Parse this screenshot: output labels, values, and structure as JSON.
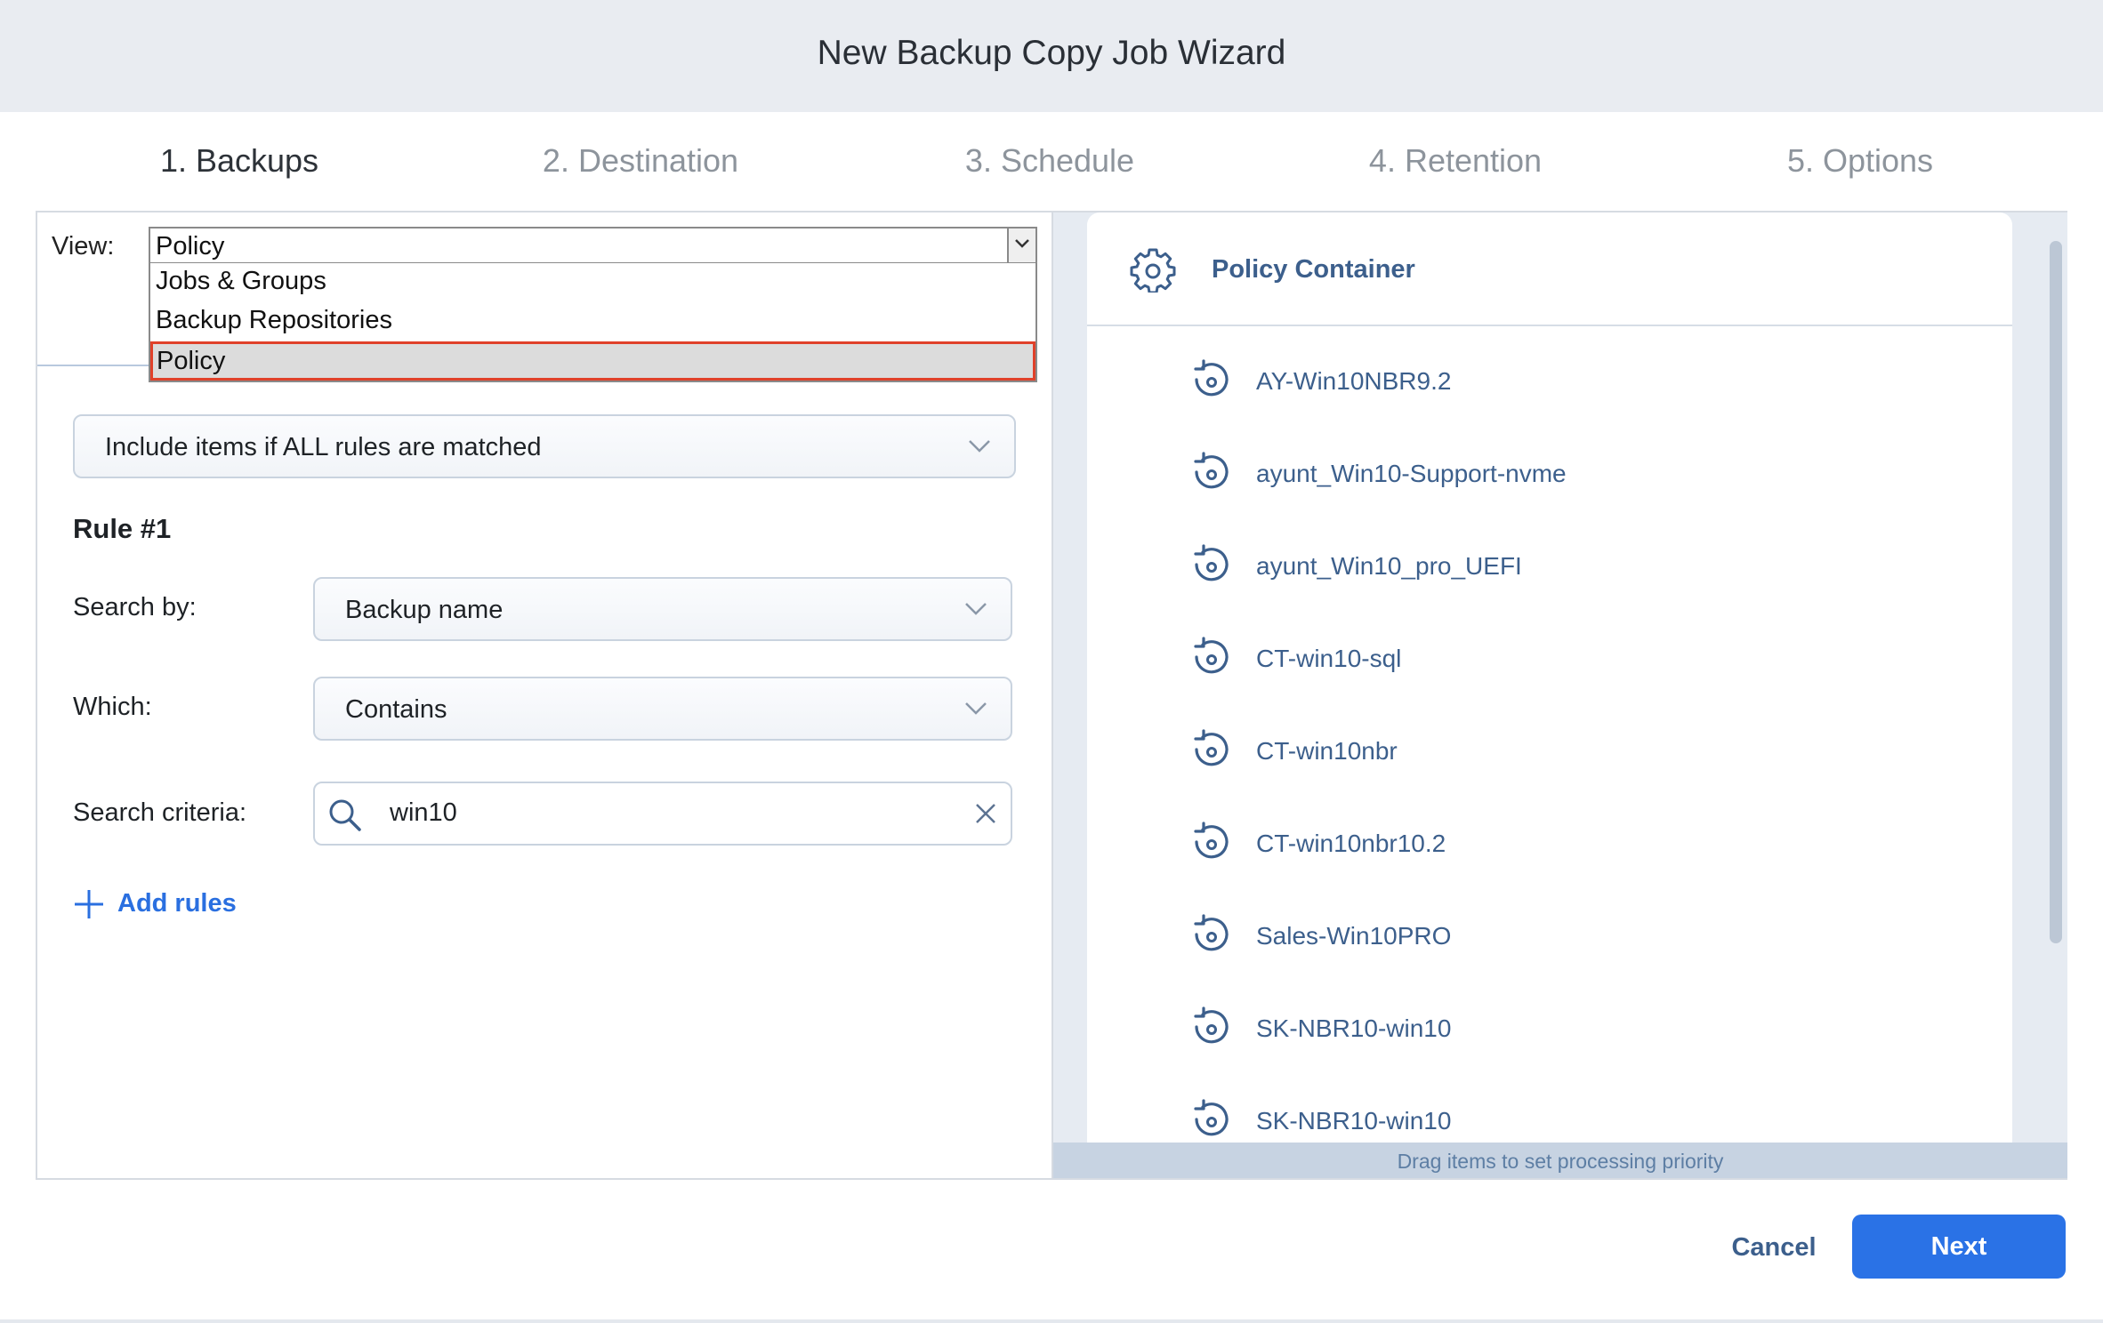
{
  "window": {
    "title": "New Backup Copy Job Wizard"
  },
  "steps": [
    {
      "label": "1. Backups",
      "active": true
    },
    {
      "label": "2. Destination",
      "active": false
    },
    {
      "label": "3. Schedule",
      "active": false
    },
    {
      "label": "4. Retention",
      "active": false
    },
    {
      "label": "5. Options",
      "active": false
    }
  ],
  "view": {
    "label": "View:",
    "selected": "Policy",
    "options": [
      "Jobs & Groups",
      "Backup Repositories",
      "Policy"
    ],
    "highlighted_option": "Policy",
    "highlight_color": "#e0412a"
  },
  "rules": {
    "match_mode": "Include items if ALL rules are matched",
    "rule_title": "Rule #1",
    "search_by_label": "Search by:",
    "search_by_value": "Backup name",
    "which_label": "Which:",
    "which_value": "Contains",
    "criteria_label": "Search criteria:",
    "criteria_value": "win10",
    "add_rules": "Add rules"
  },
  "container": {
    "title": "Policy Container",
    "icon": "gear-icon",
    "items": [
      "AY-Win10NBR9.2",
      "ayunt_Win10-Support-nvme",
      "ayunt_Win10_pro_UEFI",
      "CT-win10-sql",
      "CT-win10nbr",
      "CT-win10nbr10.2",
      "Sales-Win10PRO",
      "SK-NBR10-win10",
      "SK-NBR10-win10"
    ],
    "item_icon": "backup-restore-icon",
    "footer_hint": "Drag items to set processing priority"
  },
  "buttons": {
    "cancel": "Cancel",
    "next": "Next"
  },
  "colors": {
    "accent": "#2a72e6",
    "item_text": "#3c5f8c",
    "link": "#2a6fe0"
  }
}
